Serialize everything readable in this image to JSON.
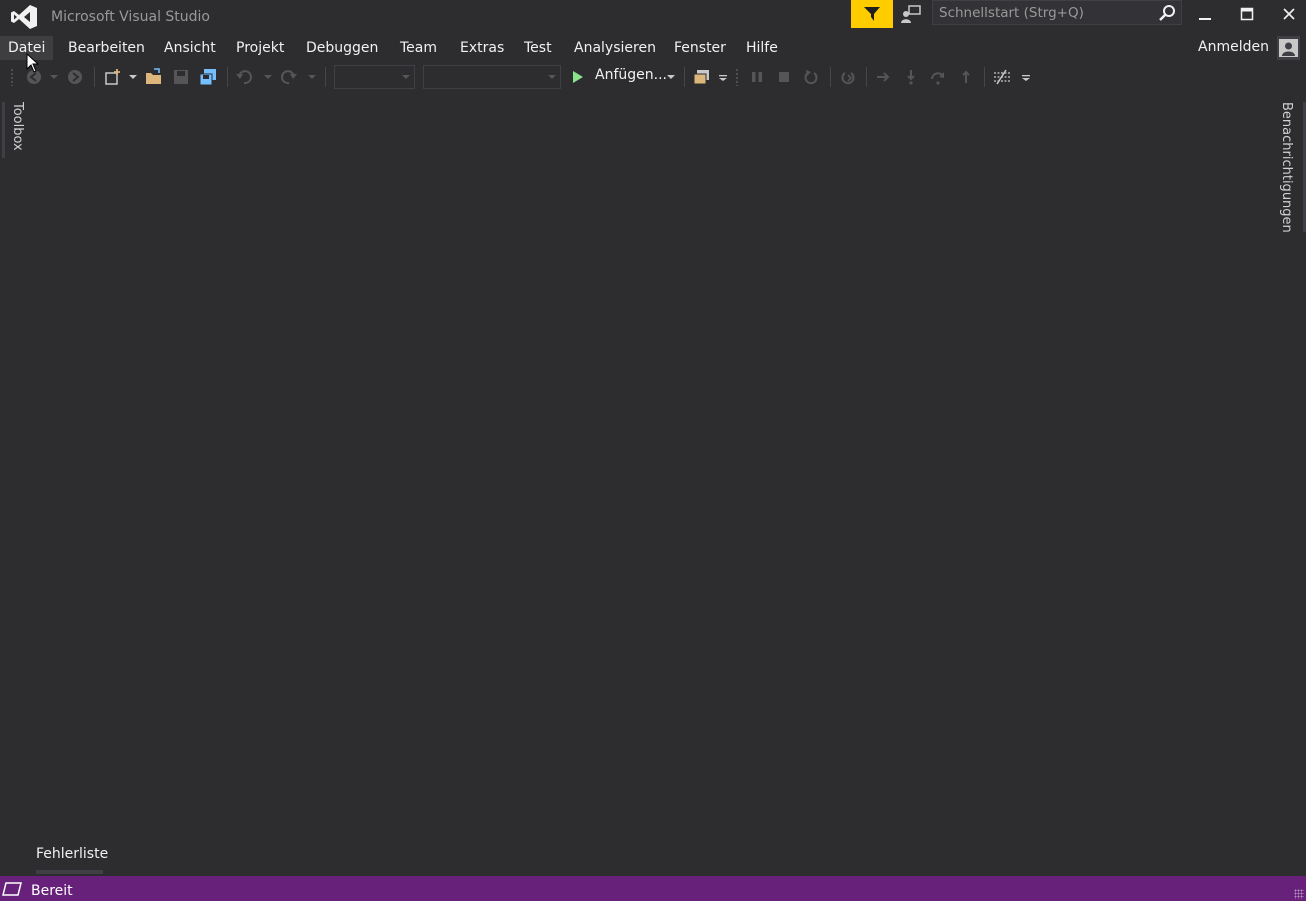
{
  "window": {
    "title": "Microsoft Visual Studio"
  },
  "quicklaunch": {
    "placeholder": "Schnellstart (Strg+Q)"
  },
  "menu": {
    "items": [
      {
        "label": "Datei"
      },
      {
        "label": "Bearbeiten"
      },
      {
        "label": "Ansicht"
      },
      {
        "label": "Projekt"
      },
      {
        "label": "Debuggen"
      },
      {
        "label": "Team"
      },
      {
        "label": "Extras"
      },
      {
        "label": "Test"
      },
      {
        "label": "Analysieren"
      },
      {
        "label": "Fenster"
      },
      {
        "label": "Hilfe"
      }
    ],
    "active_item": "Datei",
    "signin_label": "Anmelden"
  },
  "toolbar": {
    "start_label": "Anfügen...",
    "icons": [
      "back-icon",
      "forward-icon",
      "new-project-icon",
      "open-folder-icon",
      "save-icon",
      "save-all-icon",
      "undo-icon",
      "redo-icon",
      "play-icon",
      "process-icon",
      "pause-icon",
      "stop-icon",
      "restart-icon",
      "show-next-statement-icon",
      "step-into-icon",
      "step-over-icon",
      "step-out-icon",
      "customize-icon"
    ]
  },
  "sidebars": {
    "left_tab": "Toolbox",
    "right_tab": "Benachrichtigungen"
  },
  "bottom_tabs": {
    "error_list": "Fehlerliste"
  },
  "statusbar": {
    "text": "Bereit"
  },
  "colors": {
    "background": "#2d2d30",
    "statusbar": "#68217a",
    "feedback": "#ffcc00",
    "accent_folder": "#dcb67a",
    "accent_save_all": "#75beff",
    "play_green": "#8ae28a"
  }
}
